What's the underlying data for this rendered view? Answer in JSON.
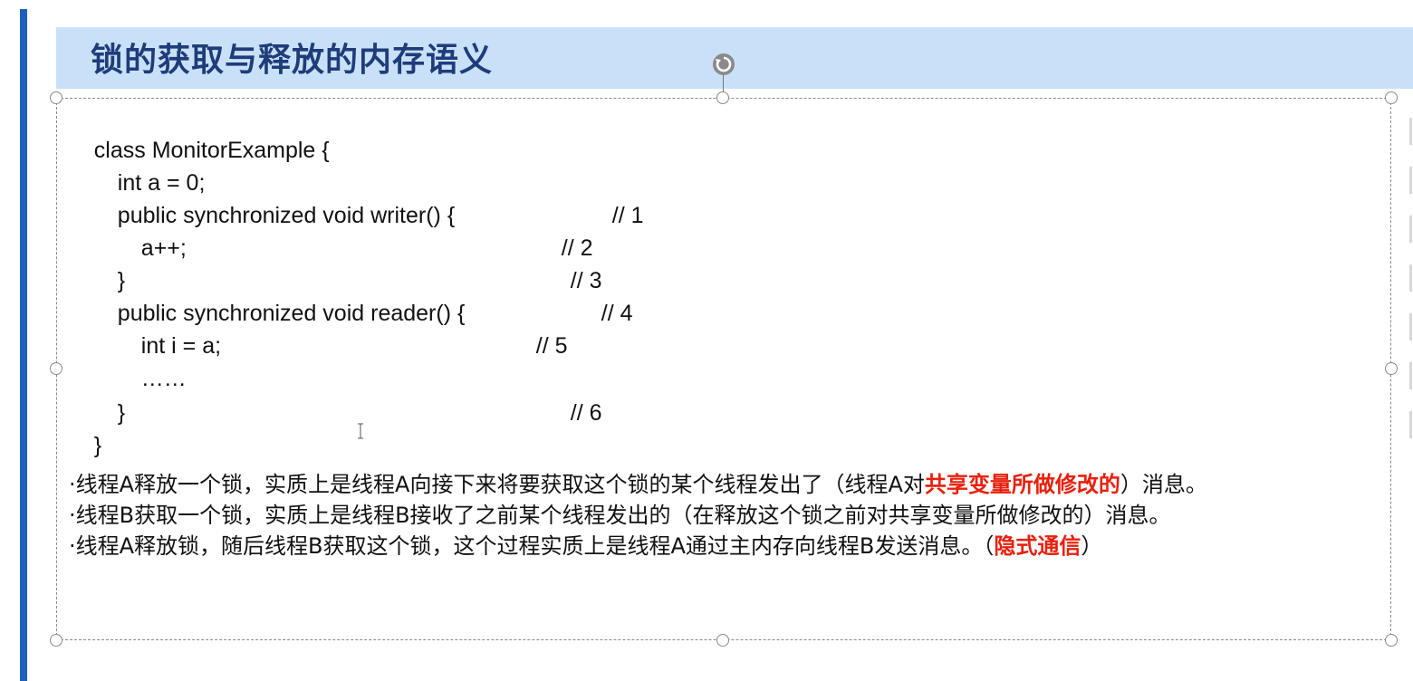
{
  "slide": {
    "title": "锁的获取与释放的内存语义",
    "code_lines": [
      {
        "code": "class MonitorExample {",
        "comment": ""
      },
      {
        "code": "int a = 0;",
        "comment": ""
      },
      {
        "code": "public synchronized void writer() {",
        "comment": "// 1"
      },
      {
        "code": "a++;",
        "comment": "// 2"
      },
      {
        "code": "}",
        "comment": "// 3"
      },
      {
        "code": "public synchronized void reader() {",
        "comment": "// 4"
      },
      {
        "code": "int i = a;",
        "comment": "// 5"
      },
      {
        "code": "……",
        "comment": ""
      },
      {
        "code": "}",
        "comment": "// 6"
      },
      {
        "code": "}",
        "comment": ""
      }
    ],
    "paragraphs": [
      {
        "before": "·线程A释放一个锁，实质上是线程A向接下来将要获取这个锁的某个线程发出了（线程A对",
        "highlight": "共享变量所做修改的",
        "after": "）消息。"
      },
      {
        "before": "·线程B获取一个锁，实质上是线程B接收了之前某个线程发出的（在释放这个锁之前对共享变量所做修改的）消息。",
        "highlight": "",
        "after": ""
      },
      {
        "before": "·线程A释放锁，随后线程B获取这个锁，这个过程实质上是线程A通过主内存向线程B发送消息。（",
        "highlight": "隐式通信",
        "after": "）"
      }
    ]
  },
  "icons": {
    "rotate": "rotate-handle-icon",
    "cursor": "text-cursor-icon"
  },
  "colors": {
    "accent": "#1f5fbf",
    "title_bg": "#c9e1f8",
    "title_text": "#1f3c7a",
    "highlight": "#e8200c",
    "text": "#111111"
  }
}
